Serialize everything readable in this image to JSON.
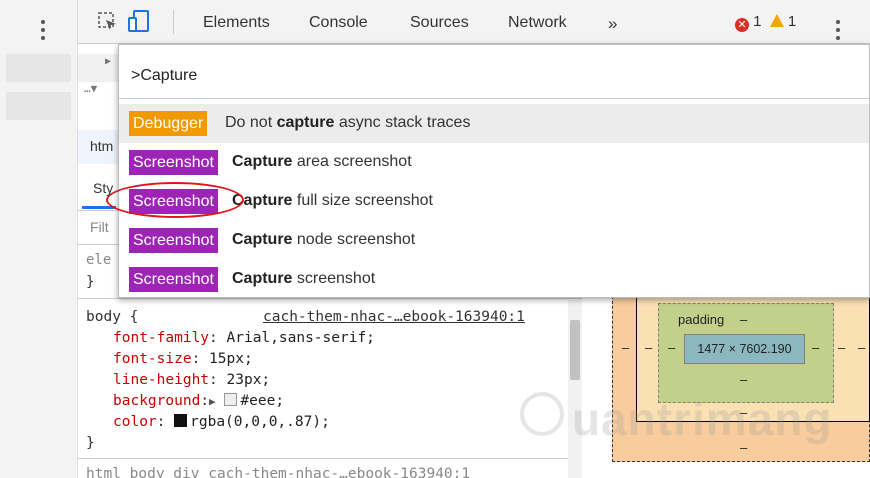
{
  "toolbar": {
    "tabs": [
      "Elements",
      "Console",
      "Sources",
      "Network"
    ],
    "more": "»",
    "error_count": "1",
    "warning_count": "1"
  },
  "elements_panel": {
    "breadcrumb_partial": "htm",
    "styles_tab_partial": "Sty",
    "filter_partial": "Filt",
    "element_style_partial": "ele",
    "brace": "}"
  },
  "command_menu": {
    "query": ">Capture",
    "items": [
      {
        "badge": "Debugger",
        "badge_color": "#f29900",
        "pre": "Do not ",
        "match": "capture",
        "post": " async stack traces"
      },
      {
        "badge": "Screenshot",
        "badge_color": "#9e24b5",
        "pre": "",
        "match": "Capture",
        "post": " area screenshot"
      },
      {
        "badge": "Screenshot",
        "badge_color": "#9e24b5",
        "pre": "",
        "match": "Capture",
        "post": " full size screenshot"
      },
      {
        "badge": "Screenshot",
        "badge_color": "#9e24b5",
        "pre": "",
        "match": "Capture",
        "post": " node screenshot"
      },
      {
        "badge": "Screenshot",
        "badge_color": "#9e24b5",
        "pre": "",
        "match": "Capture",
        "post": " screenshot"
      }
    ]
  },
  "styles": {
    "selector": "body {",
    "source_link": "cach-them-nhac-…ebook-163940:1",
    "rules": [
      {
        "prop": "font-family",
        "value": "Arial,sans-serif;"
      },
      {
        "prop": "font-size",
        "value": "15px;"
      },
      {
        "prop": "line-height",
        "value": "23px;"
      },
      {
        "prop": "background",
        "value": "#eee;"
      },
      {
        "prop": "color",
        "value": "rgba(0,0,0,.87);"
      }
    ],
    "close_brace": "}",
    "next_line": "html  body  div  cach-them-nhac-…ebook-163940:1"
  },
  "box_model": {
    "padding_label": "padding",
    "dash": "–",
    "content_size": "1477 × 7602.190"
  },
  "watermark": "uantrimang"
}
